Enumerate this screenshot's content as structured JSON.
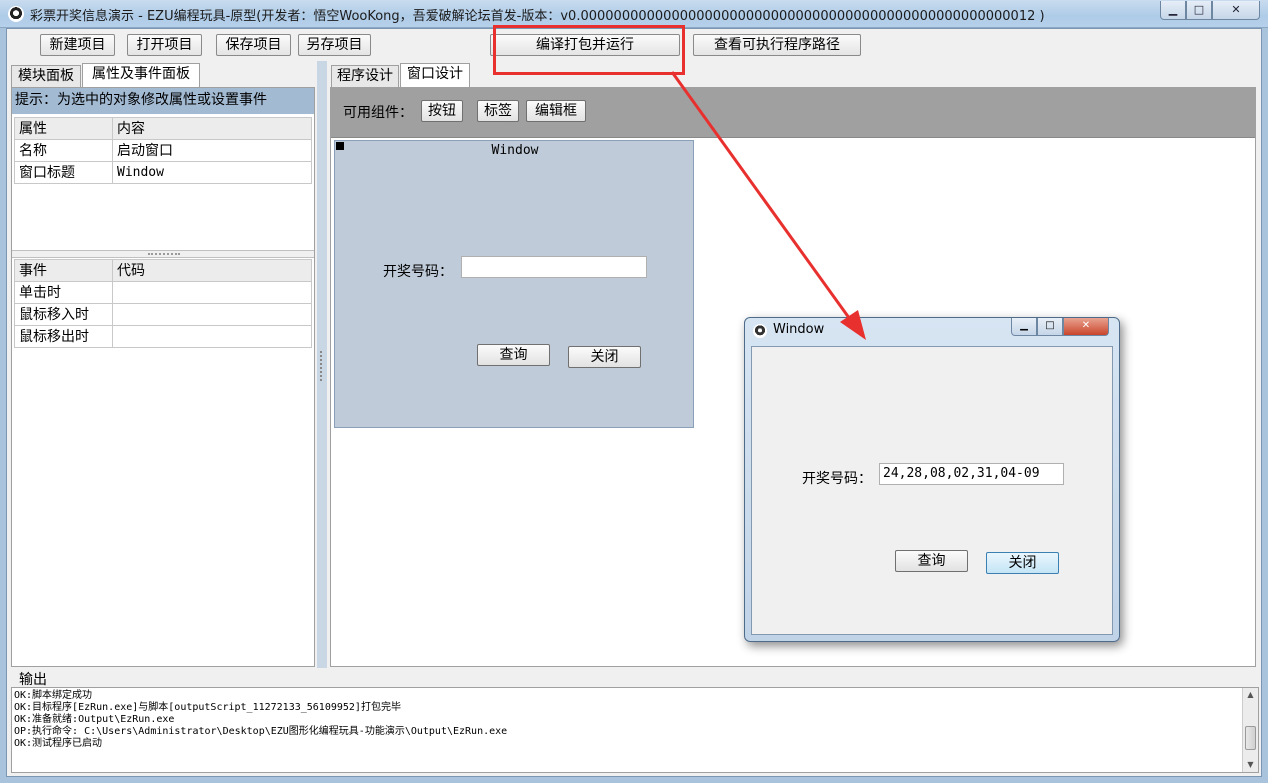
{
  "window": {
    "title": "彩票开奖信息演示 - EZU编程玩具-原型(开发者：悟空WooKong，吾爱破解论坛首发-版本：v0.0000000000000000000000000000000000000000000000000000012 )",
    "min_glyph": "▁",
    "max_glyph": "□",
    "close_glyph": "✕"
  },
  "toolbar": {
    "new_project": "新建项目",
    "open_project": "打开项目",
    "save_project": "保存项目",
    "save_as": "另存项目",
    "build_run": "编译打包并运行",
    "view_exe_path": "查看可执行程序路径"
  },
  "left_tabs": {
    "module_panel": "模块面板",
    "props_events_panel": "属性及事件面板"
  },
  "props": {
    "hint": "提示：为选中的对象修改属性或设置事件",
    "headers": {
      "property": "属性",
      "content": "内容"
    },
    "rows": [
      {
        "name": "名称",
        "value": "启动窗口"
      },
      {
        "name": "窗口标题",
        "value": "Window"
      }
    ]
  },
  "events": {
    "headers": {
      "event": "事件",
      "code": "代码"
    },
    "rows": [
      {
        "name": "单击时",
        "value": ""
      },
      {
        "name": "鼠标移入时",
        "value": ""
      },
      {
        "name": "鼠标移出时",
        "value": ""
      }
    ]
  },
  "right_tabs": {
    "program_design": "程序设计",
    "window_design": "窗口设计"
  },
  "components": {
    "label": "可用组件：",
    "button": "按钮",
    "tag": "标签",
    "editbox": "编辑框"
  },
  "design_form": {
    "title": "Window",
    "lottery_label": "开奖号码：",
    "lottery_value": "",
    "query_button": "查询",
    "close_button": "关闭"
  },
  "popup": {
    "title": "Window",
    "lottery_label": "开奖号码：",
    "lottery_value": "24,28,08,02,31,04-09",
    "query_button": "查询",
    "close_button": "关闭"
  },
  "output": {
    "label": "输出",
    "lines": [
      "OK:脚本绑定成功",
      "OK:目标程序[EzRun.exe]与脚本[outputScript_11272133_56109952]打包完毕",
      "OK:准备就绪:Output\\EzRun.exe",
      "OP:执行命令: C:\\Users\\Administrator\\Desktop\\EZU图形化编程玩具-功能演示\\Output\\EzRun.exe",
      "OK:测试程序已启动"
    ]
  },
  "colors": {
    "annotation_red": "#e8302e",
    "hint_bg": "#a3bad3",
    "component_bar": "#a0a0a0",
    "design_form_bg": "#bfcbd8"
  }
}
